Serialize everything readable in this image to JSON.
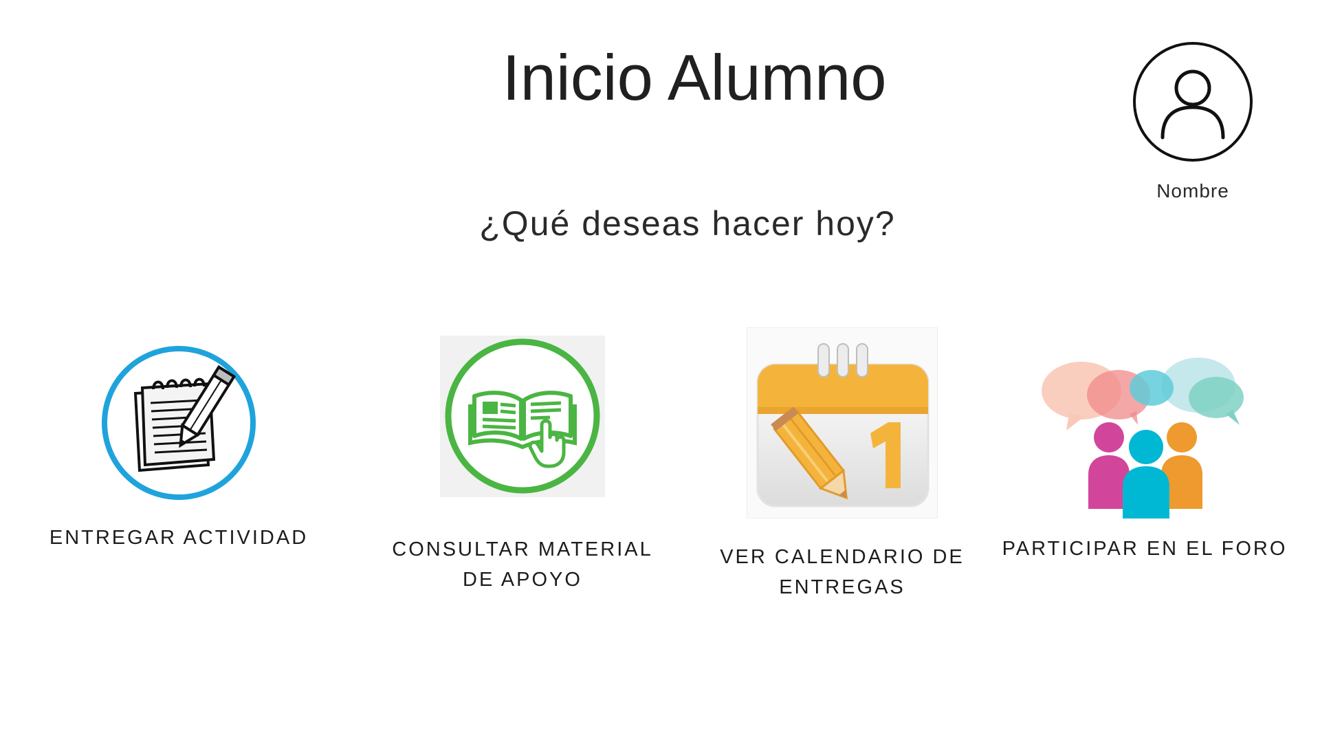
{
  "header": {
    "title": "Inicio Alumno"
  },
  "profile": {
    "name": "Nombre",
    "icon": "user-avatar-icon"
  },
  "prompt": "¿Qué deseas hacer hoy?",
  "options": [
    {
      "label": "ENTREGAR ACTIVIDAD",
      "icon": "notepad-pencil-icon",
      "accent": "#1fa3dc"
    },
    {
      "label": "CONSULTAR MATERIAL DE APOYO",
      "icon": "open-book-icon",
      "accent": "#4bb543"
    },
    {
      "label": "VER CALENDARIO DE ENTREGAS",
      "icon": "calendar-icon",
      "accent": "#f4b43c"
    },
    {
      "label": "PARTICIPAR EN EL FORO",
      "icon": "forum-people-icon",
      "accent": "#d1469a"
    }
  ]
}
